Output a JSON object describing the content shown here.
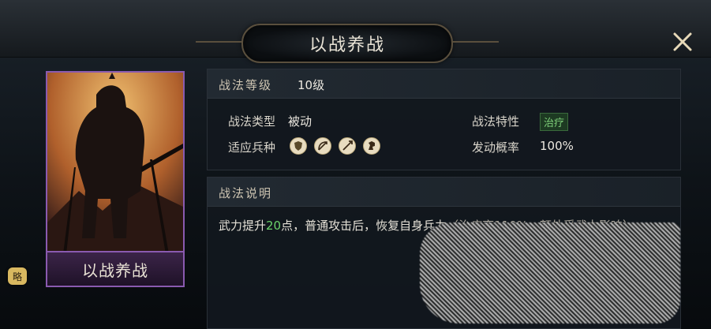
{
  "header": {
    "title": "以战养战"
  },
  "card": {
    "name": "以战养战",
    "badge": "略"
  },
  "info": {
    "level_label": "战法等级",
    "level_value": "10级",
    "type_label": "战法类型",
    "type_value": "被动",
    "trait_label": "战法特性",
    "trait_value": "治疗",
    "troop_label": "适应兵种",
    "troop_icons": [
      "shield-icon",
      "bow-icon",
      "spear-icon",
      "horse-icon"
    ],
    "rate_label": "发动概率",
    "rate_value": "100%"
  },
  "description": {
    "header": "战法说明",
    "text_before": "武力提升",
    "highlight": "20",
    "text_after": "点，普通攻击后，恢复自身兵力",
    "text_paren": "（治疗率110%，额外受武力影响）"
  },
  "colors": {
    "accent": "#8a5ab0",
    "green": "#6ad36a",
    "gold": "#d9b860"
  }
}
